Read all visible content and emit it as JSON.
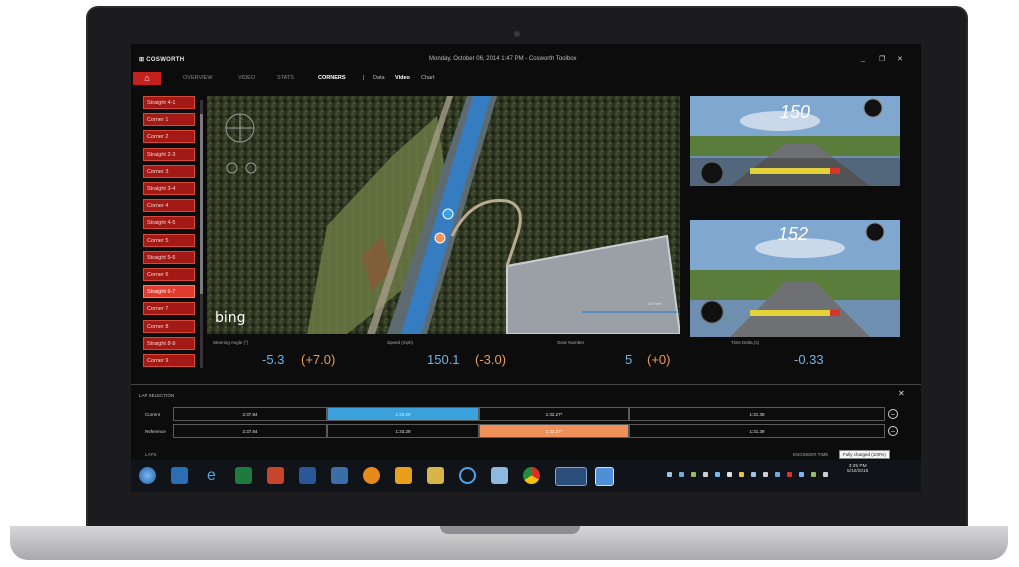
{
  "window": {
    "brand": "COSWORTH",
    "title": "Monday, October 06, 2014 1:47 PM - Cosworth Toolbox",
    "controls": [
      "_",
      "❐",
      "✕"
    ]
  },
  "nav": {
    "items": [
      "OVERVIEW",
      "VIDEO",
      "STATS",
      "CORNERS"
    ],
    "active": "CORNERS",
    "sub_items": [
      "Data",
      "Video",
      "Chart"
    ]
  },
  "corners": [
    "Straight 4-1",
    "Corner 1",
    "Corner 2",
    "Straight 2-3",
    "Corner 3",
    "Straight 3-4",
    "Corner 4",
    "Straight 4-5",
    "Corner 5",
    "Straight 5-6",
    "Corner 6",
    "Straight 6-7",
    "Corner 7",
    "Corner 8",
    "Straight 8-9",
    "Corner 9"
  ],
  "selected_corner": "Straight 6-7",
  "map": {
    "provider": "bing",
    "scale": "150 feet"
  },
  "videos": [
    {
      "speed": "150"
    },
    {
      "speed": "152"
    }
  ],
  "metrics": [
    {
      "label": "Steering Angle (°)",
      "value": "-5.3",
      "delta": "(+7.0)"
    },
    {
      "label": "Speed (mph)",
      "value": "150.1",
      "delta": "(-3.0)"
    },
    {
      "label": "Gear Number",
      "value": "5",
      "delta": "(+0)"
    },
    {
      "label": "Time Delta (s)",
      "value": "-0.33",
      "delta": ""
    }
  ],
  "lap_selection": {
    "title": "LAP SELECTION",
    "rows": [
      {
        "label": "Current",
        "cells": [
          "2:37.84",
          "1:33.29",
          "1:32.27*",
          "1:31.39"
        ]
      },
      {
        "label": "Reference",
        "cells": [
          "2:37.84",
          "1:33.29",
          "1:32.27*",
          "1:31.39"
        ]
      }
    ]
  },
  "status": {
    "left": "LAPS",
    "right": "ENGINEER TIME",
    "tooltip": "Fully charged (100%)"
  },
  "clock": {
    "time": "3:25 PM",
    "date": "5/10/2015"
  },
  "colors": {
    "accent_red": "#c4201d",
    "current_lap": "#3aa1dc",
    "reference_lap": "#f0915a",
    "value_blue": "#6db3e8",
    "delta_orange": "#e99a5a"
  }
}
